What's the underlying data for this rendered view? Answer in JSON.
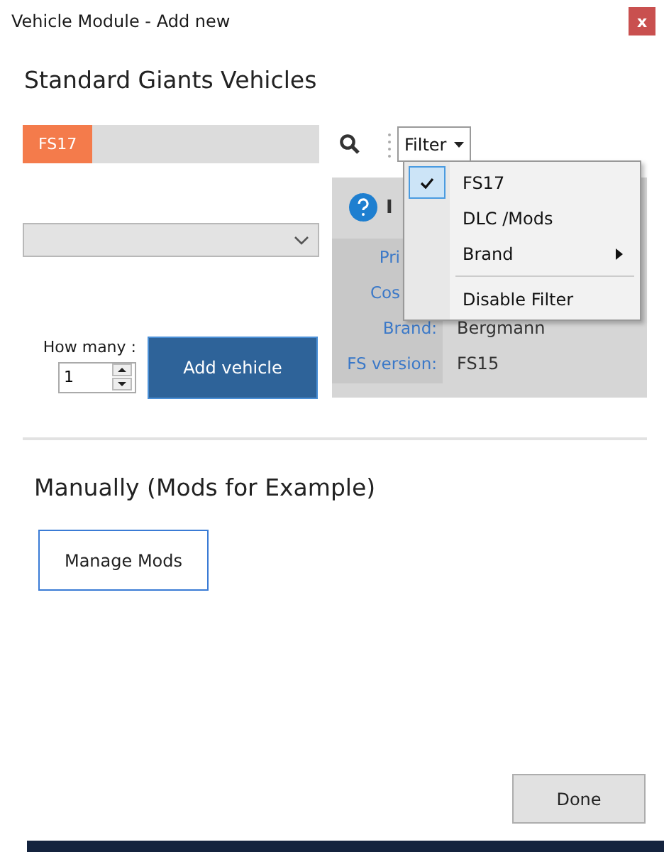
{
  "window": {
    "title": "Vehicle Module - Add new",
    "close": "x"
  },
  "heading": "Standard Giants Vehicles",
  "source_tabs": [
    {
      "label": "FS17",
      "selected": true
    }
  ],
  "filter": {
    "label": "Filter",
    "menu": [
      {
        "kind": "item",
        "label": "FS17",
        "checked": true
      },
      {
        "kind": "item",
        "label": "DLC /Mods",
        "checked": false
      },
      {
        "kind": "submenu",
        "label": "Brand",
        "checked": false
      },
      {
        "kind": "separator"
      },
      {
        "kind": "item",
        "label": "Disable Filter",
        "checked": false
      }
    ]
  },
  "quantity": {
    "label": "How many :",
    "value": "1"
  },
  "add_button": "Add vehicle",
  "info": {
    "title": "I",
    "rows": [
      {
        "label": "Pri"
      },
      {
        "label": "Cos"
      },
      {
        "label": "Brand:",
        "value": "Bergmann"
      },
      {
        "label": "FS version:",
        "value": "FS15"
      }
    ]
  },
  "manual_heading": "Manually (Mods for Example)",
  "manage_button": "Manage Mods",
  "done_button": "Done"
}
